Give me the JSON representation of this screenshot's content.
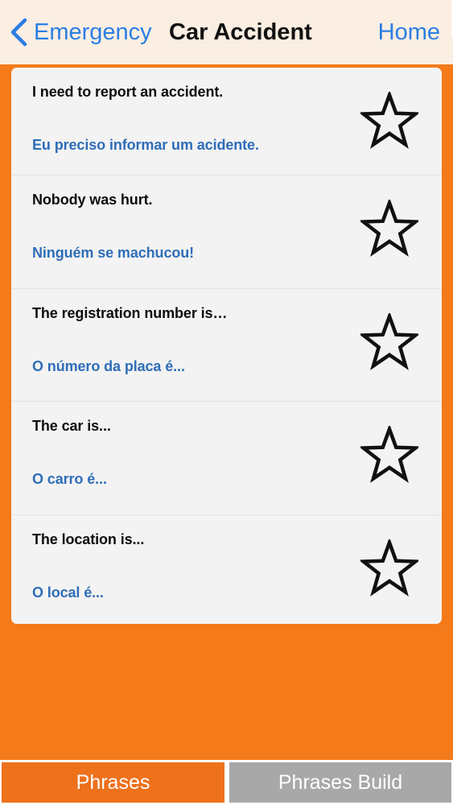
{
  "nav": {
    "back_label": "Emergency",
    "title": "Car Accident",
    "home_label": "Home"
  },
  "phrases": [
    {
      "english": "I need to report an accident.",
      "portuguese": "Eu preciso informar um acidente.",
      "icon": "star-outline-icon"
    },
    {
      "english": "Nobody was hurt.",
      "portuguese": "Ninguém se machucou!",
      "icon": "star-outline-icon"
    },
    {
      "english": "The registration number is…",
      "portuguese": "O número da placa é...",
      "icon": "star-outline-icon"
    },
    {
      "english": "The car is...",
      "portuguese": "O carro é...",
      "icon": "star-outline-icon"
    },
    {
      "english": "The location is...",
      "portuguese": "O local é...",
      "icon": "star-outline-icon"
    }
  ],
  "tabs": {
    "phrases_label": "Phrases",
    "build_label": "Phrases Build"
  },
  "colors": {
    "background": "#f47a1a",
    "nav_background": "#fbeee2",
    "link_blue": "#2b7ee3",
    "translation_blue": "#2f6db8",
    "active_tab": "#ee711c",
    "inactive_tab": "#a8a8a8"
  }
}
